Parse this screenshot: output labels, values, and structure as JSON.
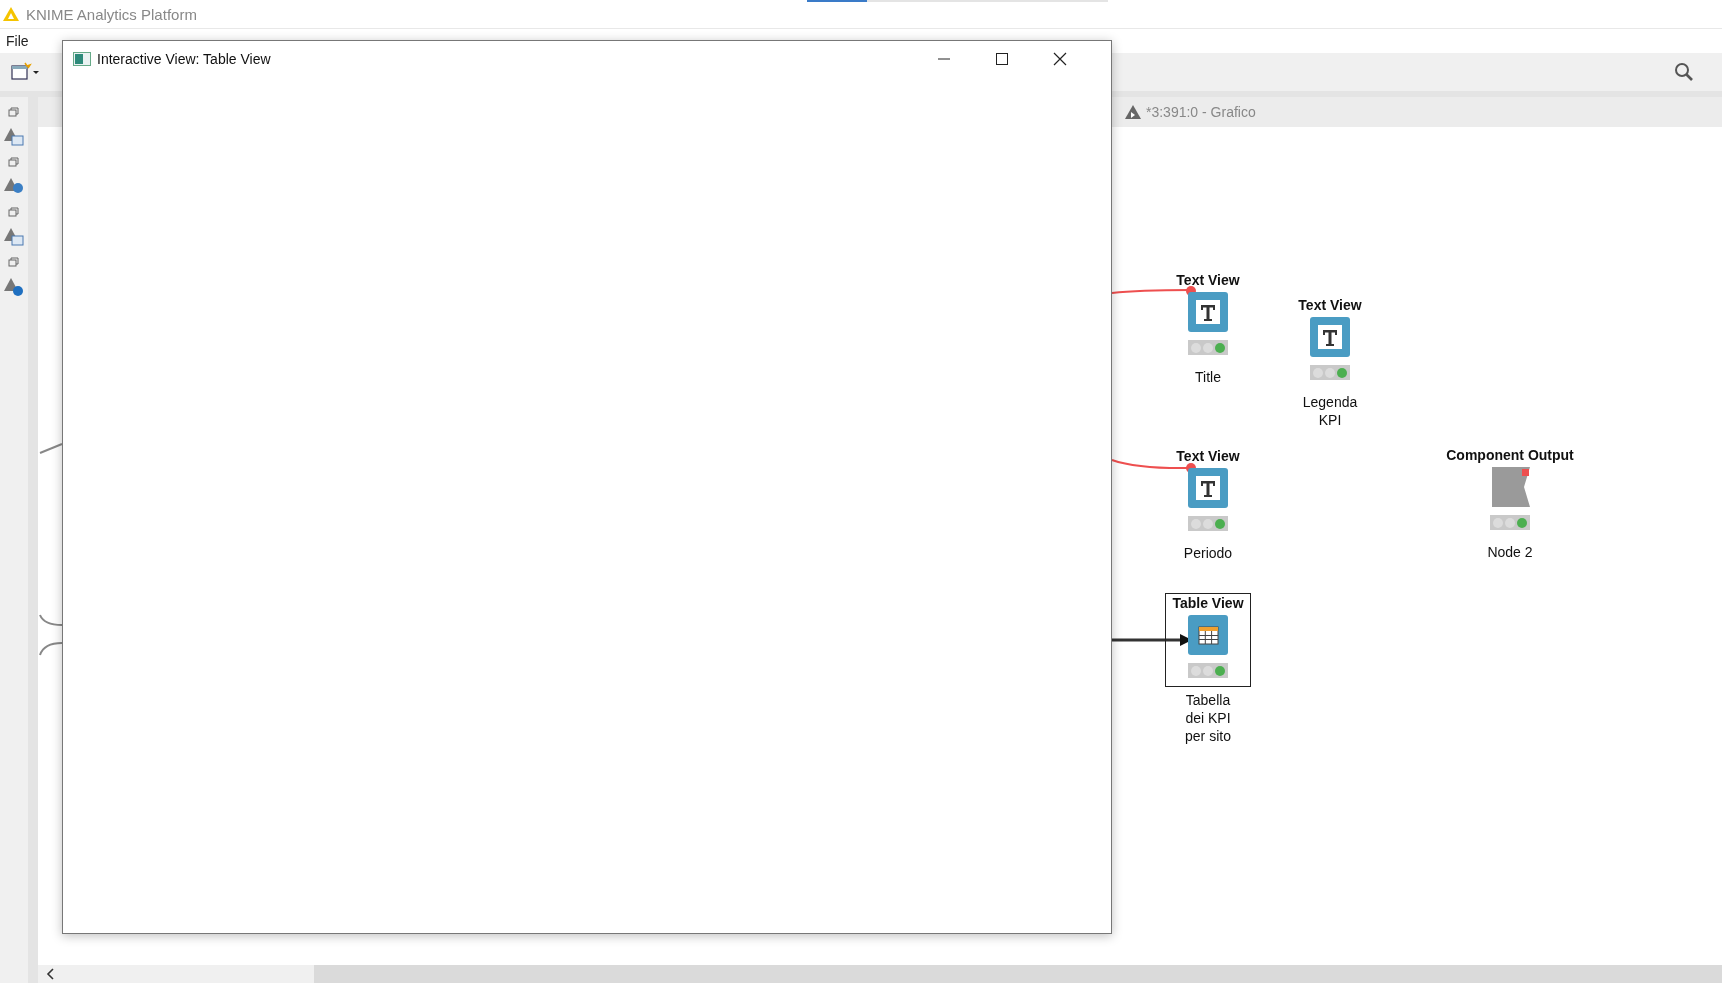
{
  "app": {
    "title": "KNIME Analytics Platform",
    "progress": {
      "level": 0.2
    }
  },
  "menu": [
    {
      "label": "File"
    }
  ],
  "editor_tab": {
    "title": "*3:391:0 - Grafico"
  },
  "dialog": {
    "title": "Interactive View: Table View"
  },
  "nodes": [
    {
      "kind": "text",
      "type_label": "Text View",
      "name": "Title",
      "executed": true,
      "selected": false
    },
    {
      "kind": "text",
      "type_label": "Text View",
      "name": "Legenda\nKPI",
      "executed": true,
      "selected": false
    },
    {
      "kind": "text",
      "type_label": "Text View",
      "name": "Periodo",
      "executed": true,
      "selected": false
    },
    {
      "kind": "output",
      "type_label": "Component Output",
      "name": "Node 2",
      "executed": true,
      "selected": false
    },
    {
      "kind": "table",
      "type_label": "Table View",
      "name": "Tabella\ndei KPI\nper sito",
      "executed": true,
      "selected": true
    }
  ]
}
